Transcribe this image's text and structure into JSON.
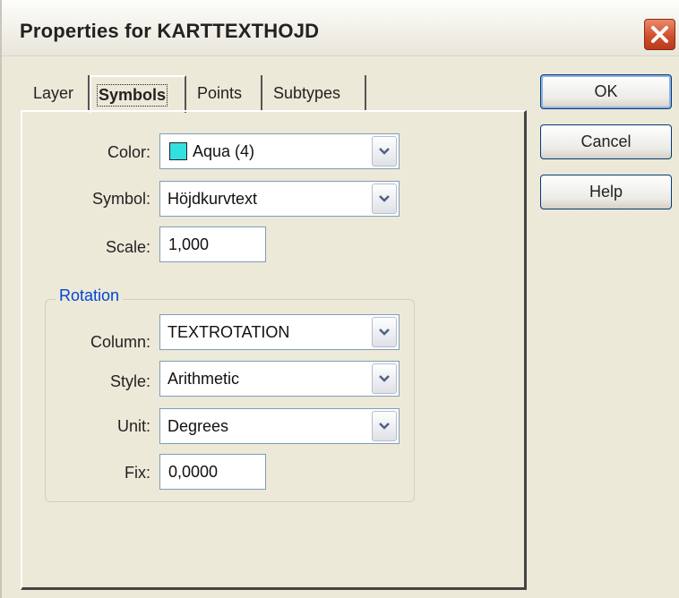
{
  "window": {
    "title": "Properties for KARTTEXTHOJD"
  },
  "tabs": [
    {
      "label": "Layer"
    },
    {
      "label": "Symbols"
    },
    {
      "label": "Points"
    },
    {
      "label": "Subtypes"
    }
  ],
  "active_tab": "Symbols",
  "symbols": {
    "color_label": "Color:",
    "color_value": "Aqua (4)",
    "color_swatch": "#33e0e0",
    "symbol_label": "Symbol:",
    "symbol_value": "Höjdkurvtext",
    "scale_label": "Scale:",
    "scale_value": "1,000"
  },
  "rotation": {
    "legend": "Rotation",
    "column_label": "Column:",
    "column_value": "TEXTROTATION",
    "style_label": "Style:",
    "style_value": "Arithmetic",
    "unit_label": "Unit:",
    "unit_value": "Degrees",
    "fix_label": "Fix:",
    "fix_value": "0,0000"
  },
  "buttons": {
    "ok": "OK",
    "cancel": "Cancel",
    "help": "Help"
  },
  "icons": {
    "close": "close-icon",
    "dropdown": "chevron-down-icon"
  },
  "colors": {
    "accent_legend": "#0046d5",
    "close_button": "#d0502e"
  }
}
